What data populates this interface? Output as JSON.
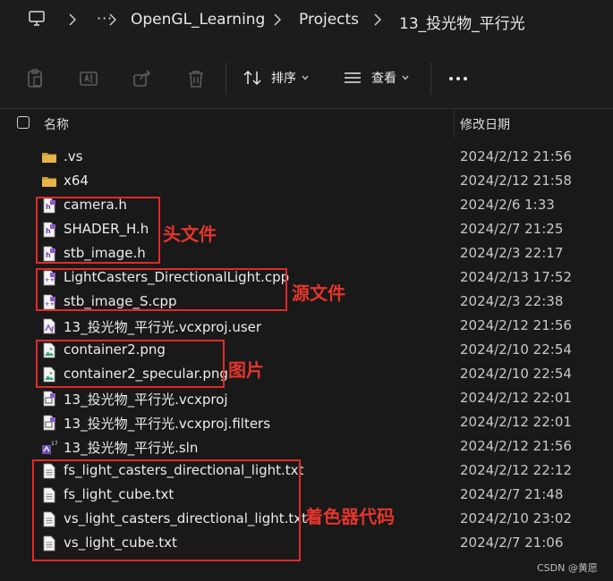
{
  "breadcrumb": {
    "more": "···",
    "items": [
      "OpenGL_Learning",
      "Projects",
      "13_投光物_平行光"
    ]
  },
  "toolbar": {
    "sort_label": "排序",
    "view_label": "查看",
    "more_label": "···"
  },
  "header": {
    "name": "名称",
    "date": "修改日期"
  },
  "files": [
    {
      "name": ".vs",
      "date": "2024/2/12 21:56",
      "icon": "folder-icon"
    },
    {
      "name": "x64",
      "date": "2024/2/12 21:58",
      "icon": "folder-icon"
    },
    {
      "name": "camera.h",
      "date": "2024/2/6 1:33",
      "icon": "header-file-icon"
    },
    {
      "name": "SHADER_H.h",
      "date": "2024/2/7 21:25",
      "icon": "header-file-icon"
    },
    {
      "name": "stb_image.h",
      "date": "2024/2/3 22:17",
      "icon": "header-file-icon"
    },
    {
      "name": "LightCasters_DirectionalLight.cpp",
      "date": "2024/2/13 17:52",
      "icon": "cpp-file-icon"
    },
    {
      "name": "stb_image_S.cpp",
      "date": "2024/2/3 22:38",
      "icon": "cpp-file-icon"
    },
    {
      "name": "13_投光物_平行光.vcxproj.user",
      "date": "2024/2/12 21:56",
      "icon": "vs-user-file-icon"
    },
    {
      "name": "container2.png",
      "date": "2024/2/10 22:54",
      "icon": "image-file-icon"
    },
    {
      "name": "container2_specular.png",
      "date": "2024/2/10 22:54",
      "icon": "image-file-icon"
    },
    {
      "name": "13_投光物_平行光.vcxproj",
      "date": "2024/2/12 22:01",
      "icon": "vcxproj-file-icon"
    },
    {
      "name": "13_投光物_平行光.vcxproj.filters",
      "date": "2024/2/12 22:01",
      "icon": "vcxproj-file-icon"
    },
    {
      "name": "13_投光物_平行光.sln",
      "date": "2024/2/12 21:56",
      "icon": "sln-file-icon"
    },
    {
      "name": "fs_light_casters_directional_light.txt",
      "date": "2024/2/12 22:12",
      "icon": "text-file-icon"
    },
    {
      "name": "fs_light_cube.txt",
      "date": "2024/2/7 21:48",
      "icon": "text-file-icon"
    },
    {
      "name": "vs_light_casters_directional_light.txt",
      "date": "2024/2/10 23:02",
      "icon": "text-file-icon"
    },
    {
      "name": "vs_light_cube.txt",
      "date": "2024/2/7 21:06",
      "icon": "text-file-icon"
    }
  ],
  "annotations": {
    "headers": "头文件",
    "sources": "源文件",
    "images": "图片",
    "shaders": "着色器代码"
  },
  "watermark": "CSDN @黄愿",
  "colors": {
    "annotation": "#e02a2a",
    "folder": "#e8b44a",
    "background": "#191919"
  }
}
